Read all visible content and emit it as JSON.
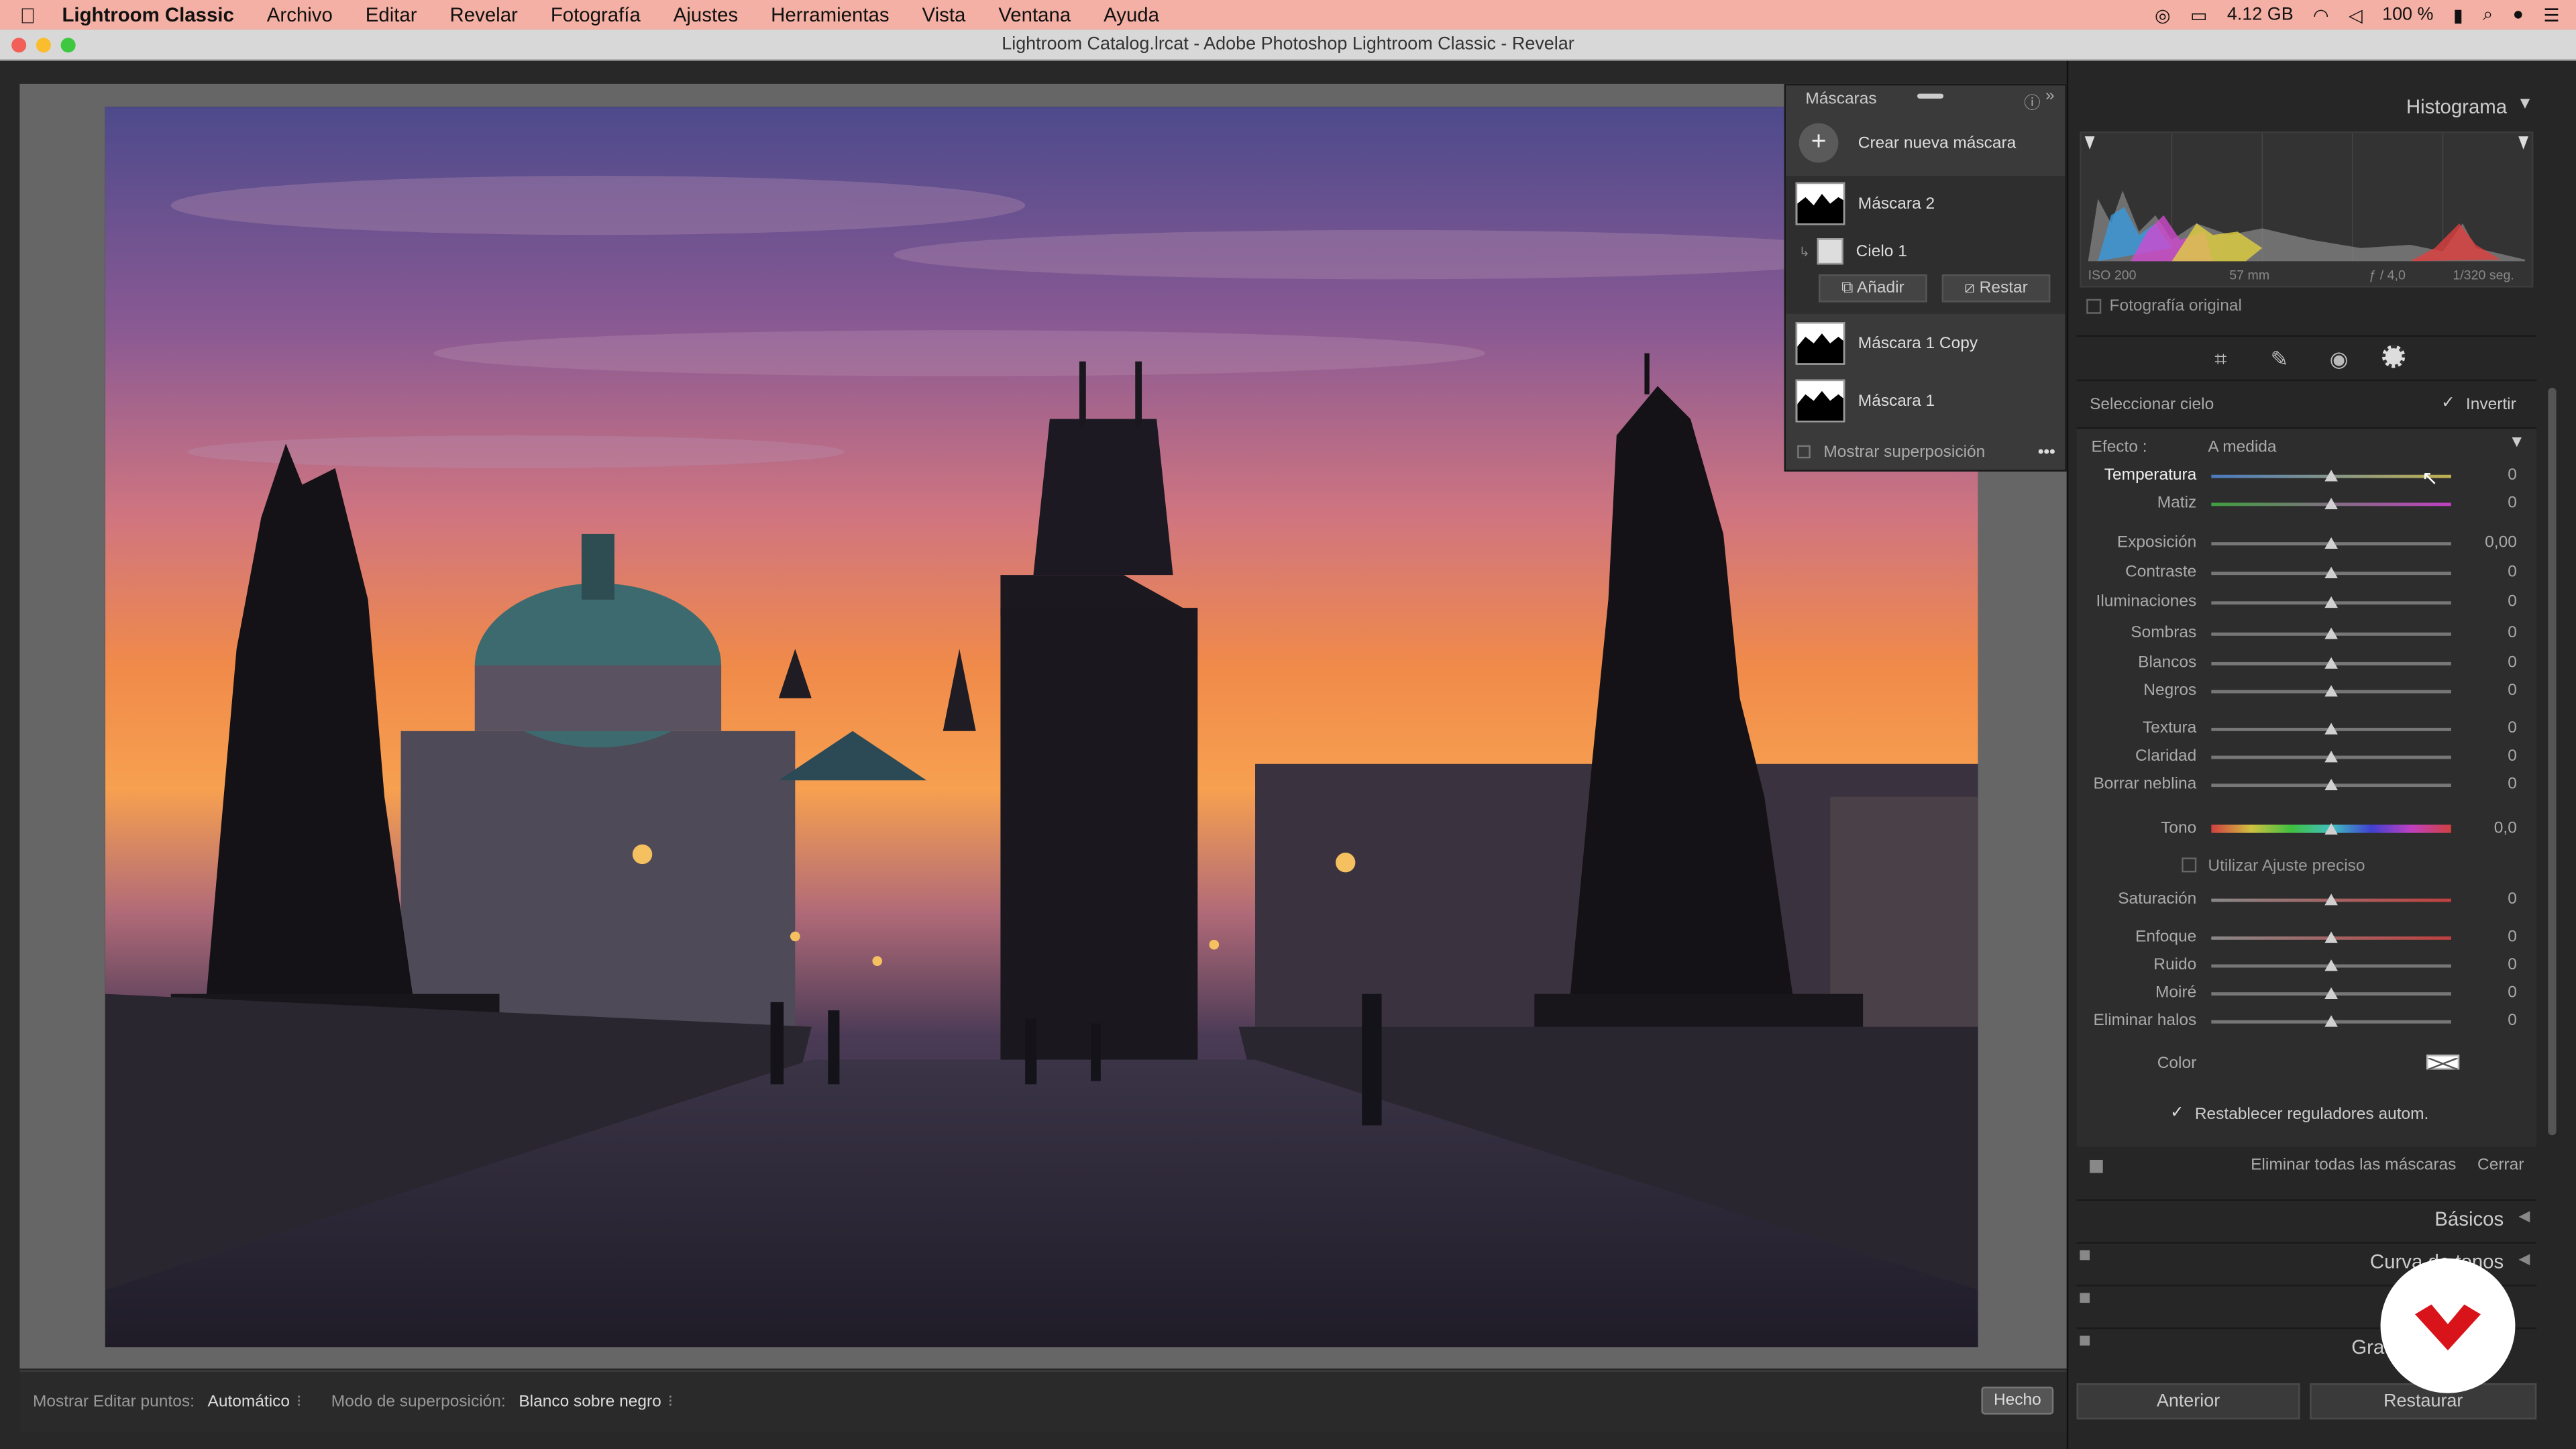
{
  "menubar": {
    "app": "Lightroom Classic",
    "items": [
      "Archivo",
      "Editar",
      "Revelar",
      "Fotografía",
      "Ajustes",
      "Herramientas",
      "Vista",
      "Ventana",
      "Ayuda"
    ],
    "memory": "4.12 GB",
    "battery": "100 %"
  },
  "window": {
    "title": "Lightroom Catalog.lrcat - Adobe Photoshop Lightroom Classic - Revelar"
  },
  "masks": {
    "title": "Máscaras",
    "create": "Crear nueva máscara",
    "items": [
      "Máscara 2",
      "Cielo 1",
      "Máscara 1 Copy",
      "Máscara 1"
    ],
    "add": "Añadir",
    "subtract": "Restar",
    "overlay": "Mostrar superposición"
  },
  "histogram": {
    "title": "Histograma",
    "iso": "ISO 200",
    "focal": "57 mm",
    "aperture": "ƒ / 4,0",
    "shutter": "1/320 seg.",
    "original": "Fotografía original"
  },
  "mask_panel": {
    "select": "Seleccionar cielo",
    "invert": "Invertir",
    "effect_label": "Efecto :",
    "effect_value": "A medida"
  },
  "sliders": [
    {
      "label": "Temperatura",
      "value": "0",
      "pos": 0.5
    },
    {
      "label": "Matiz",
      "value": "0",
      "pos": 0.5
    },
    {
      "label": "Exposición",
      "value": "0,00",
      "pos": 0.5
    },
    {
      "label": "Contraste",
      "value": "0",
      "pos": 0.5
    },
    {
      "label": "Iluminaciones",
      "value": "0",
      "pos": 0.5
    },
    {
      "label": "Sombras",
      "value": "0",
      "pos": 0.5
    },
    {
      "label": "Blancos",
      "value": "0",
      "pos": 0.5
    },
    {
      "label": "Negros",
      "value": "0",
      "pos": 0.5
    },
    {
      "label": "Textura",
      "value": "0",
      "pos": 0.5
    },
    {
      "label": "Claridad",
      "value": "0",
      "pos": 0.5
    },
    {
      "label": "Borrar neblina",
      "value": "0",
      "pos": 0.5
    },
    {
      "label": "Tono",
      "value": "0,0",
      "pos": 0.5
    },
    {
      "label": "Saturación",
      "value": "0",
      "pos": 0.5
    },
    {
      "label": "Enfoque",
      "value": "0",
      "pos": 0.5
    },
    {
      "label": "Ruido",
      "value": "0",
      "pos": 0.5
    },
    {
      "label": "Moiré",
      "value": "0",
      "pos": 0.5
    },
    {
      "label": "Eliminar halos",
      "value": "0",
      "pos": 0.5
    }
  ],
  "fine_adjust": "Utilizar Ajuste preciso",
  "color_label": "Color",
  "reset_auto": "Restablecer reguladores autom.",
  "delete_all": "Eliminar todas las máscaras",
  "close": "Cerrar",
  "sections": [
    "Básicos",
    "Curva de tonos",
    "Grad"
  ],
  "bottom": {
    "prev": "Anterior",
    "reset": "Restaurar"
  },
  "toolbar": {
    "show_label": "Mostrar Editar puntos:",
    "show_value": "Automático",
    "overlay_label": "Modo de superposición:",
    "overlay_value": "Blanco sobre negro",
    "done": "Hecho"
  }
}
